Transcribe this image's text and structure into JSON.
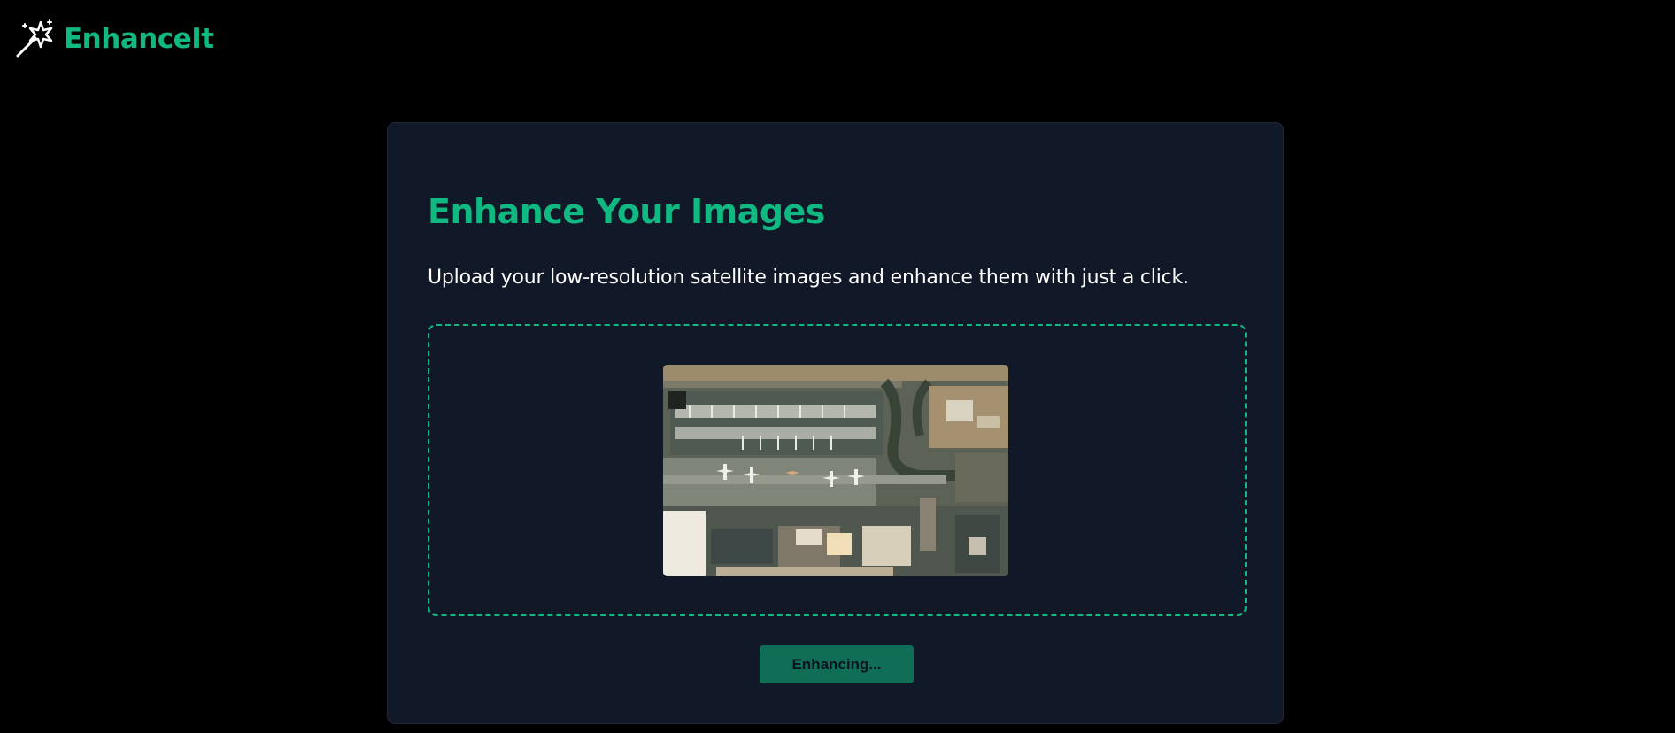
{
  "brand": {
    "name": "EnhanceIt",
    "icon": "magic-wand-icon",
    "color": "#10b981"
  },
  "main": {
    "title": "Enhance Your Images",
    "description": "Upload your low-resolution satellite images and enhance them with just a click.",
    "dropzone": {
      "border_color": "#10b981",
      "preview_image": "satellite-airport-terminal-image"
    },
    "button": {
      "label": "Enhancing...",
      "state": "disabled",
      "color": "#0f6e55"
    }
  },
  "colors": {
    "page_background": "#000000",
    "card_background": "#111827",
    "accent": "#10b981"
  }
}
